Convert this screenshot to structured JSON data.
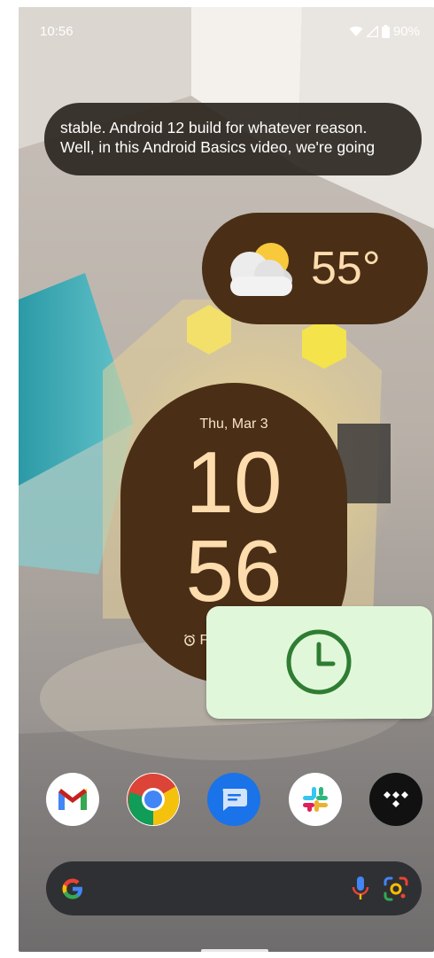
{
  "status_bar": {
    "time": "10:56",
    "battery": "90%",
    "icons": [
      "wifi-icon",
      "cellular-icon",
      "battery-icon"
    ]
  },
  "caption": {
    "line1": "stable. Android 12 build for whatever reason.",
    "line2": "Well, in this Android Basics video, we're going"
  },
  "weather_widget": {
    "temperature": "55°",
    "icon": "partly-cloudy-icon"
  },
  "clock_widget": {
    "date": "Thu, Mar 3",
    "hour": "10",
    "minute": "56",
    "alarm_partial": "F",
    "alarm_icon": "alarm-icon"
  },
  "clock_app_widget": {
    "icon": "clock-icon"
  },
  "dock": {
    "apps": [
      "Gmail",
      "Chrome",
      "Messages",
      "Slack",
      "Tidal"
    ]
  },
  "search_bar": {
    "logo": "google-g-icon",
    "mic": "mic-icon",
    "lens": "lens-icon"
  },
  "colors": {
    "widget_bg": "#4a2f16",
    "widget_text": "#ffdcae",
    "clock_app_bg": "#e1f7da",
    "clock_app_icon": "#2e7d32",
    "search_bg": "#2f3033"
  }
}
